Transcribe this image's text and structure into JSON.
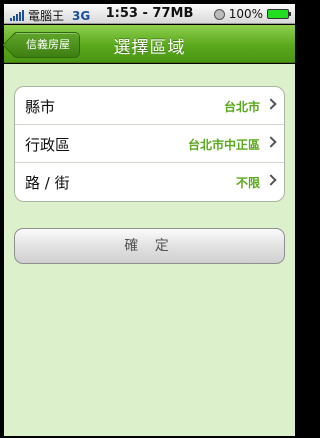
{
  "status_bar": {
    "carrier": "電腦王",
    "network": "3G",
    "center": "1:53 - 77MB",
    "battery": "100%"
  },
  "nav": {
    "back_label": "信義房屋",
    "title": "選擇區域"
  },
  "rows": [
    {
      "label": "縣市",
      "value": "台北市"
    },
    {
      "label": "行政區",
      "value": "台北市中正區"
    },
    {
      "label": "路 / 街",
      "value": "不限"
    }
  ],
  "confirm_label": "確 定",
  "colors": {
    "accent": "#5aa81c",
    "background": "#dcf0cc"
  }
}
